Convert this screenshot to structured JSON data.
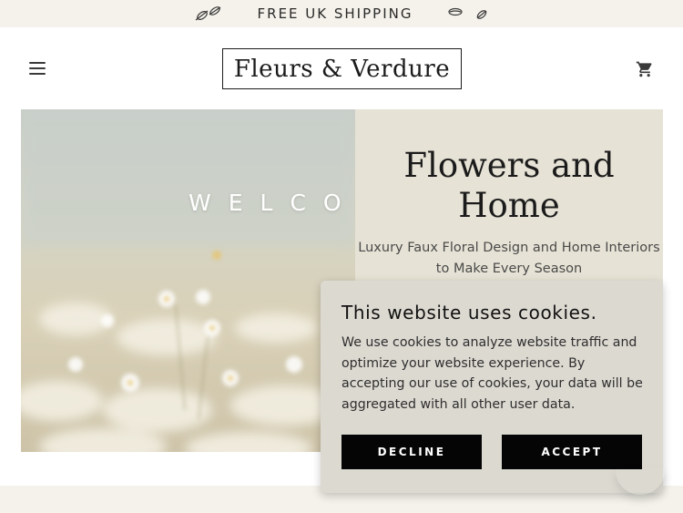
{
  "announcement": {
    "text": "FREE UK SHIPPING",
    "left_icon": "leaves-icon",
    "right_icon": "leaves-icon"
  },
  "header": {
    "menu_icon": "hamburger-menu-icon",
    "logo": "Fleurs & Verdure",
    "cart_icon": "cart-icon"
  },
  "hero": {
    "image_overlay_text": "WELCO",
    "title": "Flowers and Home",
    "subtitle": "Luxury Faux Floral Design and Home Interiors to Make Every Season"
  },
  "cookie_banner": {
    "title": "This website uses cookies.",
    "body": "We use cookies to analyze website traffic and optimize your website experience. By accepting our use of cookies, your data will be aggregated with all other user data.",
    "decline_label": "DECLINE",
    "accept_label": "ACCEPT"
  },
  "colors": {
    "announcement_bg": "#f4f2ea",
    "hero_panel_bg": "#e6e2d5",
    "cookie_bg": "#dcd9d1",
    "button_bg": "#050505"
  }
}
